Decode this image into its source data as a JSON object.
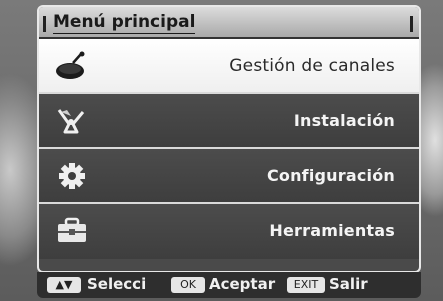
{
  "window": {
    "title": "Menú principal"
  },
  "menu": {
    "items": [
      {
        "label": "Gestión de canales",
        "icon": "satellite-dish-icon",
        "selected": true
      },
      {
        "label": "Instalación",
        "icon": "satellite-icon",
        "selected": false
      },
      {
        "label": "Configuración",
        "icon": "gear-icon",
        "selected": false
      },
      {
        "label": "Herramientas",
        "icon": "toolbox-icon",
        "selected": false
      }
    ]
  },
  "help": {
    "select_key": "▲▼",
    "select_label": "Selecci",
    "ok_key": "OK",
    "ok_label": "Aceptar",
    "exit_key": "EXIT",
    "exit_label": "Salir"
  },
  "colors": {
    "selected_bg": "#ffffff",
    "item_bg": "#444444",
    "title_bg": "#c8c8c8"
  }
}
